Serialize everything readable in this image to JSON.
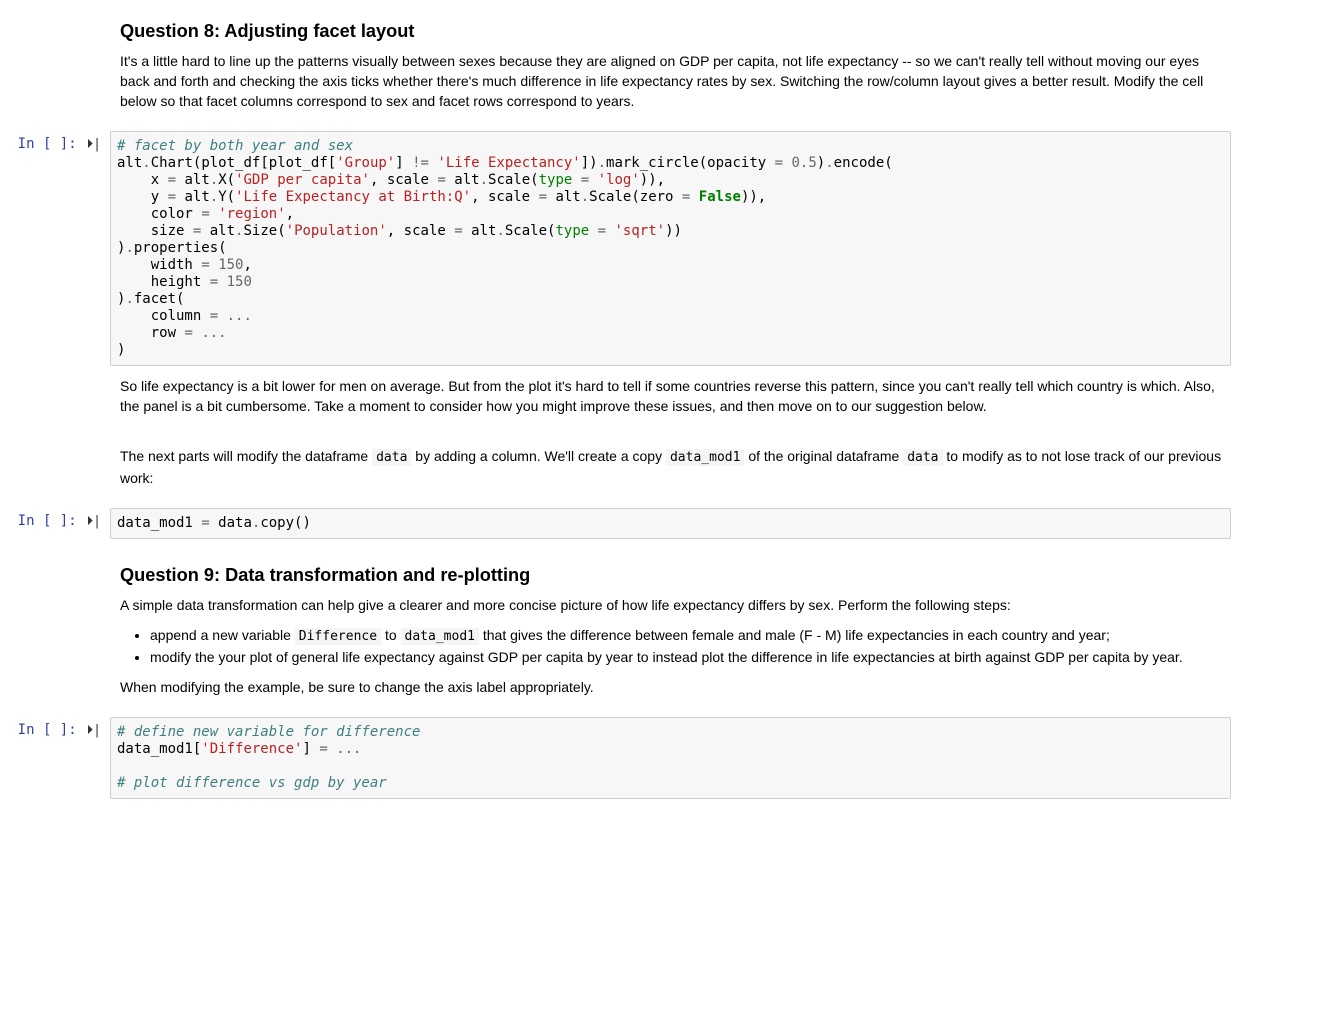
{
  "prompts": {
    "in_empty": "In [ ]:",
    "run_glyph": "▶|"
  },
  "q8": {
    "heading": "Question 8: Adjusting facet layout",
    "para": "It's a little hard to line up the patterns visually between sexes because they are aligned on GDP per capita, not life expectancy -- so we can't really tell without moving our eyes back and forth and checking the axis ticks whether there's much difference in life expectancy rates by sex. Switching the row/column layout gives a better result. Modify the cell below so that facet columns correspond to sex and facet rows correspond to years."
  },
  "code1": {
    "l1_comment": "# facet by both year and sex",
    "l2": {
      "t1": "alt",
      "dot1": ".",
      "chart": "Chart",
      "op1": "(",
      "pd1": "plot_df",
      "ob1": "[",
      "pd2": "plot_df",
      "ob2": "[",
      "s1": "'Group'",
      "cb1": "]",
      "ne": "!=",
      "s2": "'Life Expectancy'",
      "cb2": "])",
      "dot2": ".",
      "mc": "mark_circle",
      "op2": "(",
      "opac": "opacity",
      "eq": "=",
      "num": "0.5",
      "cp": ")",
      "dot3": ".",
      "enc": "encode",
      "op3": "("
    },
    "l3": {
      "indent": "    ",
      "x": "x",
      "eq": "=",
      "alt": "alt",
      "dot": ".",
      "X": "X",
      "op": "(",
      "s": "'GDP per capita'",
      "c": ",",
      "scale": "scale",
      "eq2": "=",
      "alt2": "alt",
      "dot2": ".",
      "Sc": "Scale",
      "op2": "(",
      "type": "type",
      "eq3": "=",
      "s2": "'log'",
      "cp": ")),"
    },
    "l4": {
      "indent": "    ",
      "y": "y",
      "eq": "=",
      "alt": "alt",
      "dot": ".",
      "Y": "Y",
      "op": "(",
      "s": "'Life Expectancy at Birth:Q'",
      "c": ",",
      "scale": "scale",
      "eq2": "=",
      "alt2": "alt",
      "dot2": ".",
      "Sc": "Scale",
      "op2": "(",
      "zero": "zero",
      "eq3": "=",
      "false": "False",
      "cp": ")),"
    },
    "l5": {
      "indent": "    ",
      "color": "color",
      "eq": "=",
      "s": "'region'",
      "c": ","
    },
    "l6": {
      "indent": "    ",
      "size": "size",
      "eq": "=",
      "alt": "alt",
      "dot": ".",
      "Size": "Size",
      "op": "(",
      "s": "'Population'",
      "c": ",",
      "scale": "scale",
      "eq2": "=",
      "alt2": "alt",
      "dot2": ".",
      "Sc": "Scale",
      "op2": "(",
      "type": "type",
      "eq3": "=",
      "s2": "'sqrt'",
      "cp": "))"
    },
    "l7": {
      "cp": ")",
      "dot": ".",
      "prop": "properties",
      "op": "("
    },
    "l8": {
      "indent": "    ",
      "width": "width",
      "eq": "=",
      "num": "150",
      "c": ","
    },
    "l9": {
      "indent": "    ",
      "height": "height",
      "eq": "=",
      "num": "150"
    },
    "l10": {
      "cp": ")",
      "dot": ".",
      "facet": "facet",
      "op": "("
    },
    "l11": {
      "indent": "    ",
      "column": "column",
      "eq": "=",
      "dots": "..."
    },
    "l12": {
      "indent": "    ",
      "row": "row",
      "eq": "=",
      "dots": "..."
    },
    "l13": {
      "cp": ")"
    }
  },
  "mid": {
    "para1": "So life expectancy is a bit lower for men on average. But from the plot it's hard to tell if some countries reverse this pattern, since you can't really tell which country is which. Also, the panel is a bit cumbersome. Take a moment to consider how you might improve these issues, and then move on to our suggestion below.",
    "para2_a": "The next parts will modify the dataframe ",
    "para2_code1": "data",
    "para2_b": " by adding a column. We'll create a copy ",
    "para2_code2": "data_mod1",
    "para2_c": " of the original dataframe ",
    "para2_code3": "data",
    "para2_d": " to modify as to not lose track of our previous work:"
  },
  "code2": {
    "t1": "data_mod1",
    "eq": "=",
    "t2": "data",
    "dot": ".",
    "copy": "copy",
    "par": "()"
  },
  "q9": {
    "heading": "Question 9: Data transformation and re-plotting",
    "para": "A simple data transformation can help give a clearer and more concise picture of how life expectancy differs by sex. Perform the following steps:",
    "li1_a": "append a new variable ",
    "li1_code1": "Difference",
    "li1_b": " to ",
    "li1_code2": "data_mod1",
    "li1_c": " that gives the difference between female and male (F - M) life expectancies in each country and year;",
    "li2": "modify the your plot of general life expectancy against GDP per capita by year to instead plot the difference in life expectancies at birth against GDP per capita by year.",
    "para2": "When modifying the example, be sure to change the axis label appropriately."
  },
  "code3": {
    "l1_comment": "# define new variable for difference",
    "l2": {
      "t1": "data_mod1",
      "ob": "[",
      "s": "'Difference'",
      "cb": "]",
      "eq": "=",
      "dots": "..."
    },
    "l3_blank": "",
    "l4_comment": "# plot difference vs gdp by year"
  }
}
